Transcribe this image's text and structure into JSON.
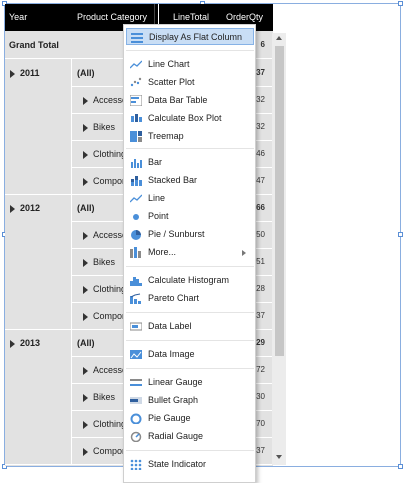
{
  "pivot": {
    "headers": {
      "year": "Year",
      "category": "Product Category",
      "line_total": "LineTotal",
      "order_qty": "OrderQty"
    },
    "grand_total": {
      "label": "Grand Total",
      "qty_suffix": "6"
    },
    "years": [
      {
        "year": "2011",
        "rows": [
          {
            "label": "(All)",
            "qty_suffix": "37"
          },
          {
            "label": "Accessor",
            "qty_suffix": "32"
          },
          {
            "label": "Bikes",
            "qty_suffix": "32"
          },
          {
            "label": "Clothing",
            "qty_suffix": "46"
          },
          {
            "label": "Compon",
            "qty_suffix": "47"
          }
        ]
      },
      {
        "year": "2012",
        "rows": [
          {
            "label": "(All)",
            "qty_suffix": "66"
          },
          {
            "label": "Accessor",
            "qty_suffix": "50"
          },
          {
            "label": "Bikes",
            "qty_suffix": "51"
          },
          {
            "label": "Clothing",
            "qty_suffix": "28"
          },
          {
            "label": "Compon",
            "qty_suffix": "37"
          }
        ]
      },
      {
        "year": "2013",
        "rows": [
          {
            "label": "(All)",
            "qty_suffix": "29"
          },
          {
            "label": "Accessor",
            "qty_suffix": "72"
          },
          {
            "label": "Bikes",
            "qty_suffix": "30"
          },
          {
            "label": "Clothing",
            "qty_suffix": "70"
          },
          {
            "label": "Compon",
            "qty_suffix": "37"
          }
        ]
      }
    ]
  },
  "menu": {
    "items": [
      {
        "label": "Display As Flat Column",
        "icon": "flat-column-icon",
        "highlighted": true
      },
      {
        "label": "Line Chart",
        "icon": "line-chart-icon"
      },
      {
        "label": "Scatter Plot",
        "icon": "scatter-plot-icon"
      },
      {
        "label": "Data Bar Table",
        "icon": "data-bar-table-icon"
      },
      {
        "label": "Calculate Box Plot",
        "icon": "box-plot-icon"
      },
      {
        "label": "Treemap",
        "icon": "treemap-icon"
      },
      {
        "label": "Bar",
        "icon": "bar-icon"
      },
      {
        "label": "Stacked Bar",
        "icon": "stacked-bar-icon"
      },
      {
        "label": "Line",
        "icon": "line-icon"
      },
      {
        "label": "Point",
        "icon": "point-icon"
      },
      {
        "label": "Pie / Sunburst",
        "icon": "pie-icon"
      },
      {
        "label": "More...",
        "icon": "more-icon",
        "submenu": true
      },
      {
        "label": "Calculate Histogram",
        "icon": "histogram-icon"
      },
      {
        "label": "Pareto Chart",
        "icon": "pareto-icon"
      },
      {
        "label": "Data Label",
        "icon": "data-label-icon"
      },
      {
        "label": "Data Image",
        "icon": "data-image-icon"
      },
      {
        "label": "Linear Gauge",
        "icon": "linear-gauge-icon"
      },
      {
        "label": "Bullet Graph",
        "icon": "bullet-graph-icon"
      },
      {
        "label": "Pie Gauge",
        "icon": "pie-gauge-icon"
      },
      {
        "label": "Radial Gauge",
        "icon": "radial-gauge-icon"
      },
      {
        "label": "State Indicator",
        "icon": "state-indicator-icon"
      }
    ]
  },
  "colors": {
    "accent": "#4a8fd9",
    "highlight": "#c9def5",
    "header_bg": "#000000",
    "grid_bg": "#e2e2e2"
  }
}
